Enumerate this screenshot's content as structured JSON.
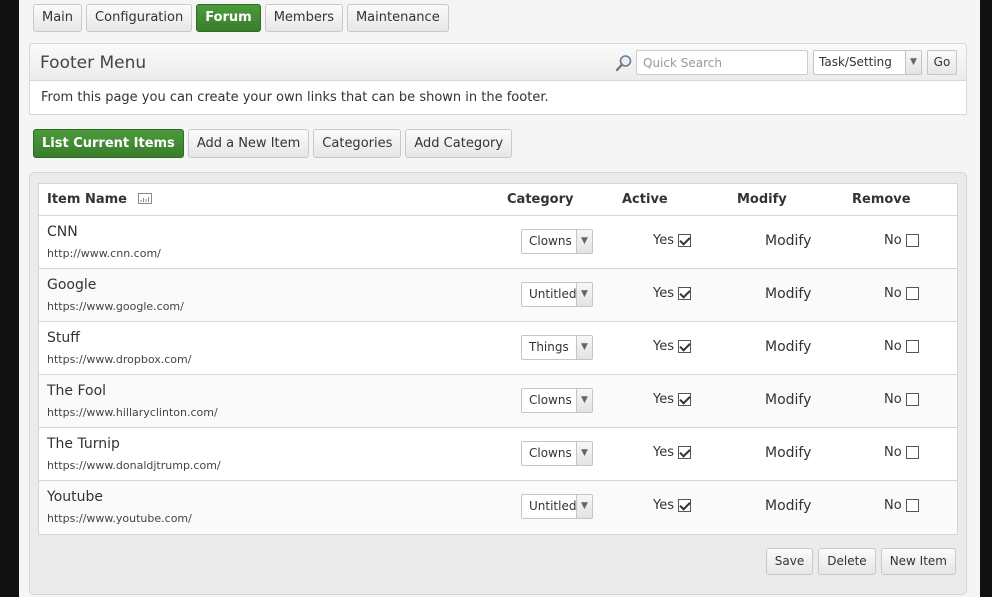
{
  "tabs": [
    {
      "label": "Main",
      "active": false
    },
    {
      "label": "Configuration",
      "active": false
    },
    {
      "label": "Forum",
      "active": true
    },
    {
      "label": "Members",
      "active": false
    },
    {
      "label": "Maintenance",
      "active": false
    }
  ],
  "header": {
    "title": "Footer Menu",
    "search_placeholder": "Quick Search",
    "task_select": "Task/Setting",
    "go_label": "Go"
  },
  "intro": "From this page you can create your own links that can be shown in the footer.",
  "actions": [
    {
      "label": "List Current Items",
      "active": true
    },
    {
      "label": "Add a New Item",
      "active": false
    },
    {
      "label": "Categories",
      "active": false
    },
    {
      "label": "Add Category",
      "active": false
    }
  ],
  "table": {
    "headers": {
      "name": "Item Name",
      "category": "Category",
      "active": "Active",
      "modify": "Modify",
      "remove": "Remove"
    },
    "rows": [
      {
        "name": "CNN",
        "url": "http://www.cnn.com/",
        "category": "Clowns",
        "active_label": "Yes",
        "active": true,
        "modify": "Modify",
        "remove_label": "No",
        "remove": false
      },
      {
        "name": "Google",
        "url": "https://www.google.com/",
        "category": "Untitled",
        "active_label": "Yes",
        "active": true,
        "modify": "Modify",
        "remove_label": "No",
        "remove": false
      },
      {
        "name": "Stuff",
        "url": "https://www.dropbox.com/",
        "category": "Things",
        "active_label": "Yes",
        "active": true,
        "modify": "Modify",
        "remove_label": "No",
        "remove": false
      },
      {
        "name": "The Fool",
        "url": "https://www.hillaryclinton.com/",
        "category": "Clowns",
        "active_label": "Yes",
        "active": true,
        "modify": "Modify",
        "remove_label": "No",
        "remove": false
      },
      {
        "name": "The Turnip",
        "url": "https://www.donaldjtrump.com/",
        "category": "Clowns",
        "active_label": "Yes",
        "active": true,
        "modify": "Modify",
        "remove_label": "No",
        "remove": false
      },
      {
        "name": "Youtube",
        "url": "https://www.youtube.com/",
        "category": "Untitled",
        "active_label": "Yes",
        "active": true,
        "modify": "Modify",
        "remove_label": "No",
        "remove": false
      }
    ]
  },
  "footer_buttons": {
    "save": "Save",
    "delete": "Delete",
    "new_item": "New Item"
  },
  "colors": {
    "accent": "#3f8732",
    "background": "#f5f5f5"
  }
}
